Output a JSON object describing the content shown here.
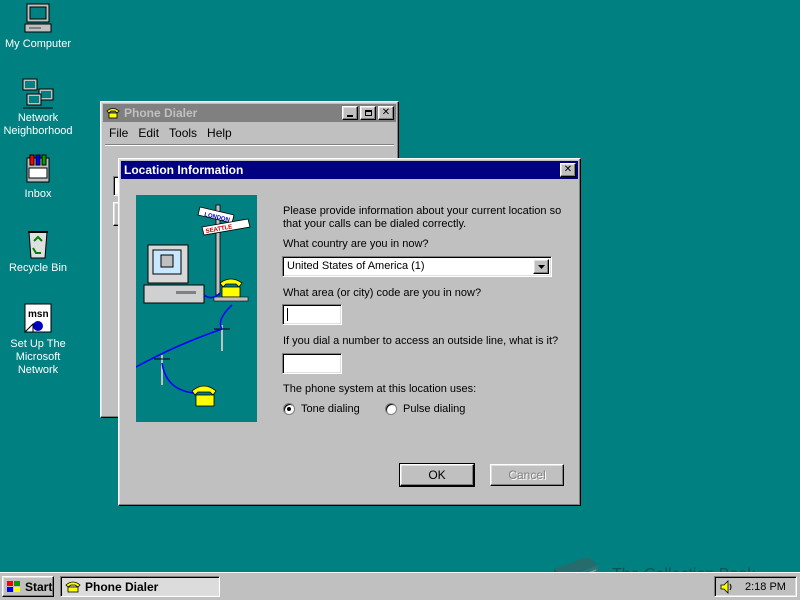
{
  "desktop": {
    "icons": [
      {
        "label": "My Computer"
      },
      {
        "label": "Network Neighborhood"
      },
      {
        "label": "Inbox"
      },
      {
        "label": "Recycle Bin"
      },
      {
        "label": "Set Up The Microsoft Network"
      }
    ]
  },
  "phone_dialer": {
    "title": "Phone Dialer",
    "menu": [
      "File",
      "Edit",
      "Tools",
      "Help"
    ]
  },
  "dialog": {
    "title": "Location Information",
    "intro": "Please provide information about your current location so that your calls can be dialed correctly.",
    "country_label": "What country are you in now?",
    "country_value": "United States of America (1)",
    "area_label": "What area (or city) code are you in now?",
    "area_value": "",
    "outside_label": "If you dial a number to access an outside line, what is it?",
    "outside_value": "",
    "phone_system_label": "The phone system at this location uses:",
    "tone_label": "Tone dialing",
    "pulse_label": "Pulse dialing",
    "selected_dialing": "tone",
    "ok_label": "OK",
    "cancel_label": "Cancel",
    "illustration_signs": [
      "LONDON",
      "SEATTLE"
    ]
  },
  "taskbar": {
    "start_label": "Start",
    "task_label": "Phone Dialer",
    "clock": "2:18 PM"
  },
  "watermark": "The Collection Book",
  "colors": {
    "desktop": "#008080",
    "active_title": "#000080",
    "inactive_title": "#808080",
    "illustration_bg": "#008080"
  }
}
